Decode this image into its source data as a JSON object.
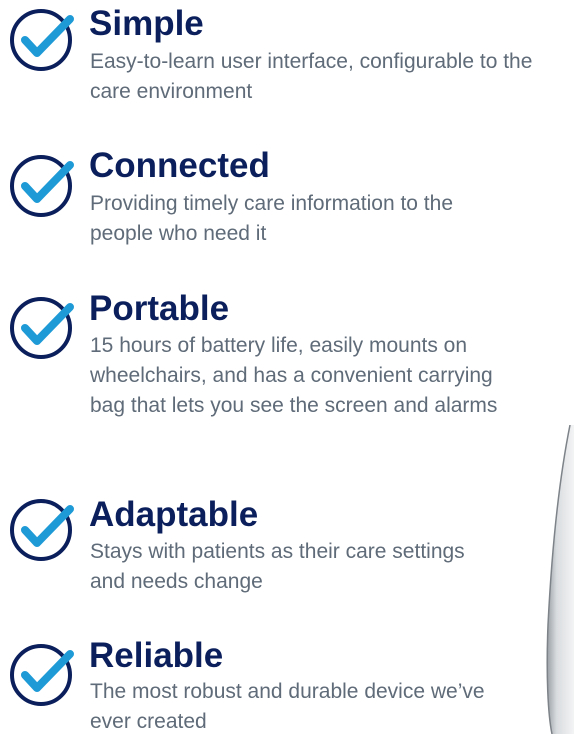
{
  "features": [
    {
      "title": "Simple",
      "description": "Easy-to-learn user interface, configurable to the care environment",
      "icon": "check-circle-icon"
    },
    {
      "title": "Connected",
      "description": "Providing timely care information to the people who need it",
      "icon": "check-circle-icon"
    },
    {
      "title": "Portable",
      "description": "15 hours of battery life, easily mounts on wheelchairs, and has a convenient carrying bag that lets you see the screen and alarms",
      "icon": "check-circle-icon"
    },
    {
      "title": "Adaptable",
      "description": "Stays with patients as their care settings and needs change",
      "icon": "check-circle-icon"
    },
    {
      "title": "Reliable",
      "description": "The most robust and durable device we’ve ever created",
      "icon": "check-circle-icon"
    }
  ],
  "colors": {
    "title": "#0b1f5c",
    "description": "#5f6b78",
    "check_circle": "#0b1f5c",
    "check_mark": "#1e9ad6"
  }
}
